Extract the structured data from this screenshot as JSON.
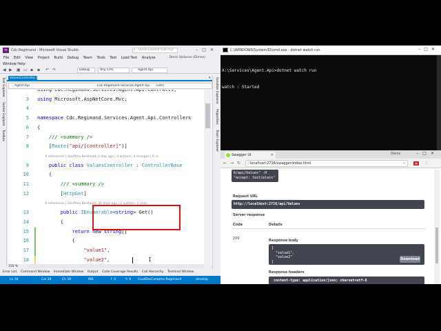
{
  "vs": {
    "title": "Cdc.Regimand - Microsoft Visual Studio",
    "quick_launch": "Quick Launch (Ctrl+Q)",
    "user": "Denis Voituron (Dimex)",
    "menu": [
      "File",
      "Edit",
      "View",
      "Project",
      "Build",
      "Debug",
      "Team",
      "Tools",
      "Test",
      "Load Test",
      "Analyze"
    ],
    "menu_row2": "Window   Help",
    "toolbar": {
      "config": "Debug",
      "platform": "Any CPU",
      "startup": "Agent.Api"
    },
    "tab": "ValuesController.cs*",
    "nav": {
      "project": "Agent.Api",
      "class": "Cdc.Regimand.Services.Agent.Api.Co",
      "member": "Get()"
    },
    "left_sidebar": [
      "Test Explorer",
      "Server Explorer",
      "Toolbox"
    ],
    "right_sidebar": [
      "Solution Explorer",
      "Properties",
      "Team Explorer"
    ],
    "code": [
      {
        "ln": "",
        "parts": [
          {
            "c": "",
            "t": "using Cdc.Regimand.Services.Agent.Api.Contracts;"
          }
        ]
      },
      {
        "ln": "3",
        "parts": [
          {
            "c": "kw",
            "t": "using "
          },
          {
            "c": "",
            "t": "Microsoft.AspNetCore.Mvc;"
          }
        ]
      },
      {
        "ln": "4",
        "parts": []
      },
      {
        "ln": "5",
        "parts": [
          {
            "c": "kw",
            "t": "namespace "
          },
          {
            "c": "",
            "t": "Cdc.Regimand.Services.Agent.Api.Controllers"
          }
        ]
      },
      {
        "ln": "6",
        "parts": [
          {
            "c": "",
            "t": "{"
          }
        ]
      },
      {
        "ln": "7",
        "parts": [
          {
            "c": "com",
            "t": "    /// <summary />"
          }
        ]
      },
      {
        "ln": "8",
        "parts": [
          {
            "c": "",
            "t": "    ["
          },
          {
            "c": "typ",
            "t": "Route"
          },
          {
            "c": "",
            "t": "("
          },
          {
            "c": "str",
            "t": "\"api/[controller]\""
          },
          {
            "c": "",
            "t": ")]"
          }
        ]
      },
      {
        "ln": "",
        "lens": "0 references | Geoffrey Berthelot, 1 day ago | 3 authors, 4 changes | 0 re"
      },
      {
        "ln": "9",
        "parts": [
          {
            "c": "kw",
            "t": "    public class "
          },
          {
            "c": "typ",
            "t": "ValuesController"
          },
          {
            "c": "",
            "t": " : "
          },
          {
            "c": "typ",
            "t": "ControllerBase"
          }
        ]
      },
      {
        "ln": "10",
        "parts": [
          {
            "c": "",
            "t": "    {"
          }
        ]
      },
      {
        "ln": "11",
        "parts": [
          {
            "c": "com",
            "t": "        /// <summary />"
          }
        ]
      },
      {
        "ln": "12",
        "parts": [
          {
            "c": "",
            "t": "        ["
          },
          {
            "c": "typ",
            "t": "HttpGet"
          },
          {
            "c": "",
            "t": "]"
          }
        ]
      },
      {
        "ln": "",
        "lens": "0 references | Geoffrey Berthelot, 31 days ago | 2 authors, 2 chan"
      },
      {
        "ln": "13",
        "parts": [
          {
            "c": "kw",
            "t": "        public "
          },
          {
            "c": "typ",
            "t": "IEnumerable"
          },
          {
            "c": "",
            "t": "<"
          },
          {
            "c": "kw",
            "t": "string"
          },
          {
            "c": "",
            "t": "> Get()"
          }
        ]
      },
      {
        "ln": "14",
        "parts": [
          {
            "c": "",
            "t": "        {"
          }
        ]
      },
      {
        "ln": "15",
        "parts": [
          {
            "c": "kw",
            "t": "            return new string"
          },
          {
            "c": "",
            "t": "[]"
          }
        ]
      },
      {
        "ln": "16",
        "parts": [
          {
            "c": "",
            "t": "            {"
          }
        ]
      },
      {
        "ln": "17",
        "parts": [
          {
            "c": "str",
            "t": "                \"value1\""
          },
          {
            "c": "",
            "t": ","
          }
        ]
      },
      {
        "ln": "18",
        "parts": [
          {
            "c": "str",
            "t": "                \"value2\""
          },
          {
            "c": "",
            "t": ","
          }
        ]
      },
      {
        "ln": "19",
        "parts": [
          {
            "c": "",
            "t": "            };"
          }
        ]
      },
      {
        "ln": "20",
        "parts": [
          {
            "c": "",
            "t": "        }"
          }
        ]
      },
      {
        "ln": "21",
        "parts": []
      },
      {
        "ln": "22",
        "parts": []
      },
      {
        "ln": "23",
        "parts": []
      },
      {
        "ln": "24",
        "parts": []
      }
    ],
    "zoom": "150 %",
    "bottom_tabs": [
      "Error List",
      "Command Window",
      "Immediate Window",
      "Output",
      "Code Coverage Results",
      "Call Hierarchy",
      "Terminal Window"
    ],
    "status": {
      "ln": "Ln 18",
      "col": "Col 28",
      "ch": "Ch 28",
      "ins": "INS",
      "up": "↑ 0",
      "edit": "✎ 9",
      "repo": "CoutDesComptes.Regimand",
      "branch": "develop"
    }
  },
  "cmd": {
    "title": "C:\\WINDOWS\\System32\\cmd.exe - dotnet  watch run",
    "lines": [
      "X:\\Services\\Agent.Api>dotnet watch run",
      "watch : Started"
    ]
  },
  "browser": {
    "tab": "Swagger UI",
    "user_label": "Denis",
    "url": "localhost:2716/swagger/index.html",
    "curl_box": "6/api/Values\" -H\n\"accept: text/plain\"",
    "request_url_label": "Request URL",
    "request_url": "http://localhost:2716/api/Values",
    "server_response_label": "Server response",
    "code_header": "Code",
    "details_header": "Details",
    "code_value": "200",
    "response_body_label": "Response body",
    "response_body": "[\n  \"value1\",\n  \"value2\"\n]",
    "download": "Download",
    "response_headers_label": "Response headers",
    "response_headers": " content-type: application/json; charset=utf-8"
  }
}
